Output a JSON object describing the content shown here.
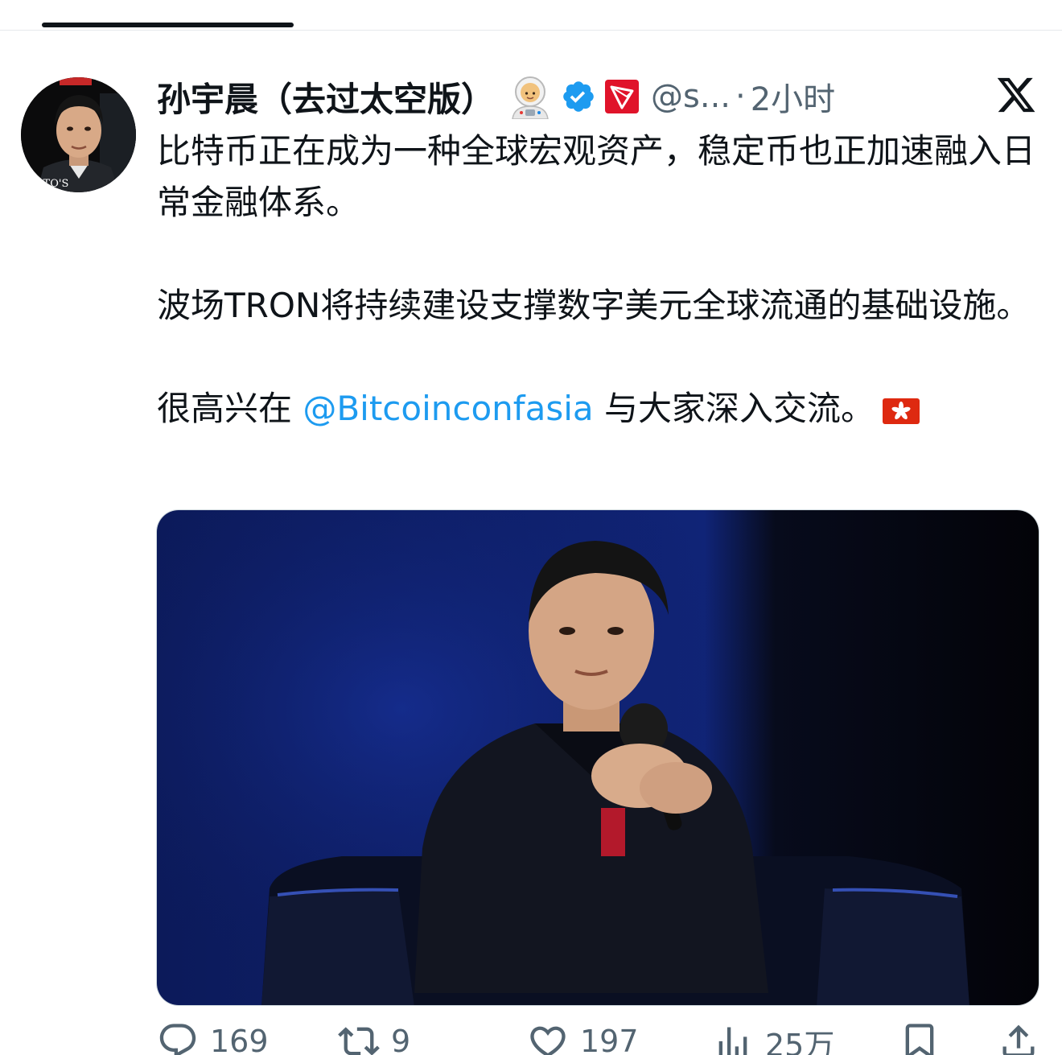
{
  "tweet": {
    "display_name": "孙宇晨（去过太空版）",
    "handle": "@s...",
    "separator": "·",
    "time": "2小时",
    "avatar_logo_text": "RTO'S",
    "paragraphs": {
      "p1": "比特币正在成为一种全球宏观资产，稳定币也正加速融入日常金融体系。",
      "p2": "波场TRON将持续建设支撑数字美元全球流通的基础设施。",
      "p3_before": "很高兴在 ",
      "p3_mention": "@Bitcoinconfasia",
      "p3_after": " 与大家深入交流。"
    },
    "metrics": {
      "replies": "169",
      "reposts": "9",
      "likes": "197",
      "views": "25万"
    }
  },
  "colors": {
    "text": "#0f1419",
    "secondary": "#536471",
    "link": "#1d9bf0",
    "verified": "#1d9bf0",
    "tron_red": "#e0132a",
    "flag_red": "#de2910"
  },
  "icons": {
    "astronaut": "astronaut-emoji",
    "verified": "verified-badge-icon",
    "tron": "tron-logo-icon",
    "x": "x-logo-icon",
    "reply": "reply-icon",
    "repost": "repost-icon",
    "like": "heart-icon",
    "views": "views-icon",
    "bookmark": "bookmark-icon",
    "share": "share-icon"
  }
}
